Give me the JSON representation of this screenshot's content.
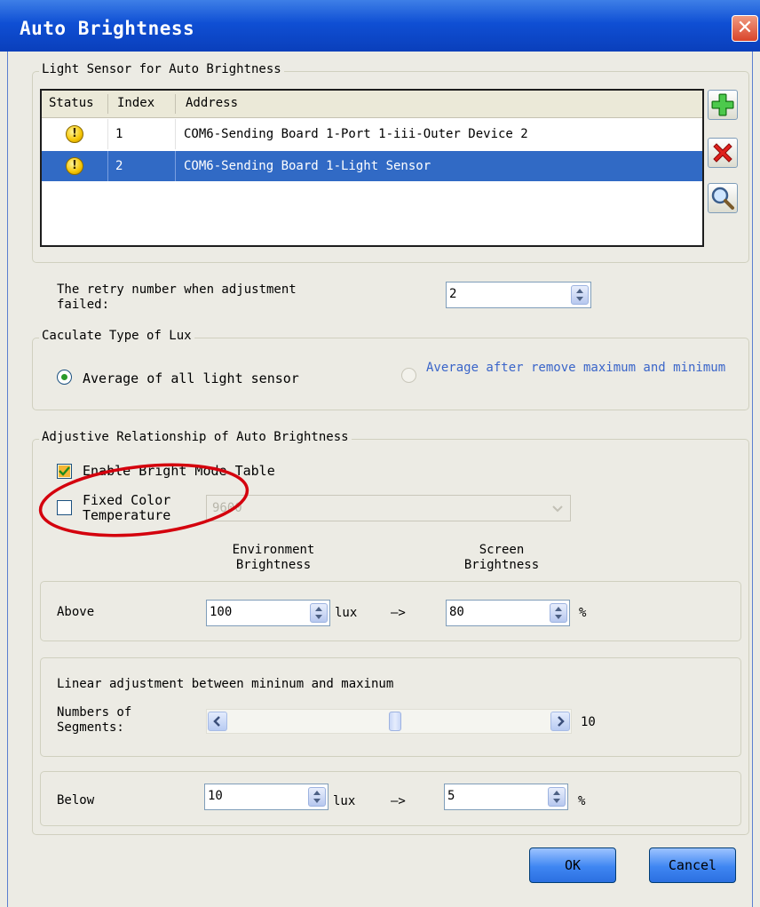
{
  "window": {
    "title": "Auto Brightness",
    "close_glyph": "✕"
  },
  "light_sensor": {
    "legend": "Light Sensor for Auto Brightness",
    "columns": [
      "Status",
      "Index",
      "Address"
    ],
    "rows": [
      {
        "status_icon": "warning-icon",
        "status_glyph": "!",
        "index": "1",
        "address": "COM6-Sending Board 1-Port 1-iii-Outer Device 2",
        "selected": false
      },
      {
        "status_icon": "warning-icon",
        "status_glyph": "!",
        "index": "2",
        "address": "COM6-Sending Board 1-Light Sensor",
        "selected": true
      }
    ],
    "side_buttons": [
      "add-icon",
      "delete-icon",
      "search-icon"
    ]
  },
  "retry": {
    "label": "The retry number when adjustment failed:",
    "value": "2"
  },
  "lux_type": {
    "legend": "Caculate Type of Lux",
    "options": [
      {
        "label": "Average of all light sensor",
        "checked": true,
        "enabled": true
      },
      {
        "label": "Average after remove maximum and minimum",
        "checked": false,
        "enabled": false
      }
    ]
  },
  "adjustive": {
    "legend": "Adjustive Relationship of Auto Brightness",
    "enable_bright_mode": {
      "label": "Enable Bright Mode Table",
      "checked": true
    },
    "fixed_color": {
      "label": "Fixed Color Temperature",
      "checked": false,
      "value": "9600"
    },
    "env_header": "Environment Brightness",
    "screen_header": "Screen Brightness",
    "above": {
      "label": "Above",
      "lux": "100",
      "lux_unit": "lux",
      "arrow": "—>",
      "percent": "80",
      "percent_unit": "%"
    },
    "linear": {
      "label": "Linear adjustment between mininum and maxinum",
      "segments_label": "Numbers of Segments:",
      "segments_value": "10",
      "slider_position": 0.52
    },
    "below": {
      "label": "Below",
      "lux": "10",
      "lux_unit": "lux",
      "arrow": "—>",
      "percent": "5",
      "percent_unit": "%"
    }
  },
  "buttons": {
    "ok": "OK",
    "cancel": "Cancel"
  },
  "annotation_color": "#d4000d"
}
